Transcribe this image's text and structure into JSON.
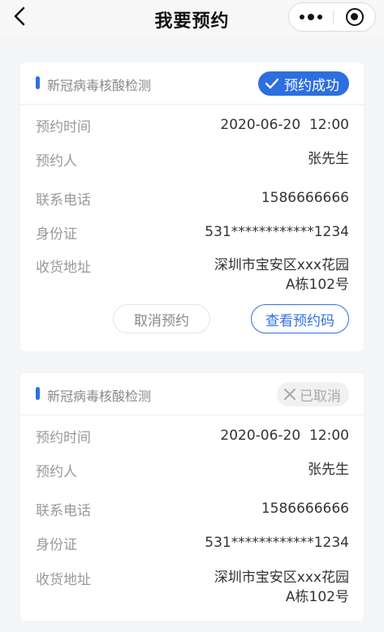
{
  "nav": {
    "title": "我要预约"
  },
  "labels": {
    "time": "预约时间",
    "person": "预约人",
    "phone": "联系电话",
    "id": "身份证",
    "address": "收货地址"
  },
  "cards": [
    {
      "title": "新冠病毒核酸检测",
      "status": "预约成功",
      "status_type": "success",
      "time": "2020-06-20  12:00",
      "person": "张先生",
      "phone": "1586666666",
      "id": "531************1234",
      "address_line1": "深圳市宝安区xxx花园",
      "address_line2": "A栋102号",
      "buttons": {
        "cancel": "取消预约",
        "view": "查看预约码"
      }
    },
    {
      "title": "新冠病毒核酸检测",
      "status": "已取消",
      "status_type": "cancelled",
      "time": "2020-06-20  12:00",
      "person": "张先生",
      "phone": "1586666666",
      "id": "531************1234",
      "address_line1": "深圳市宝安区xxx花园",
      "address_line2": "A栋102号"
    }
  ],
  "colors": {
    "accent": "#2f6fe4",
    "background": "#f4f5f7",
    "label": "#999999",
    "cancelled_badge": "#f1f1f1"
  },
  "icons": {
    "back": "chevron-left-icon",
    "more": "more-dots-icon",
    "close_app": "target-circle-icon",
    "success": "check-icon",
    "cancelled": "close-icon"
  }
}
